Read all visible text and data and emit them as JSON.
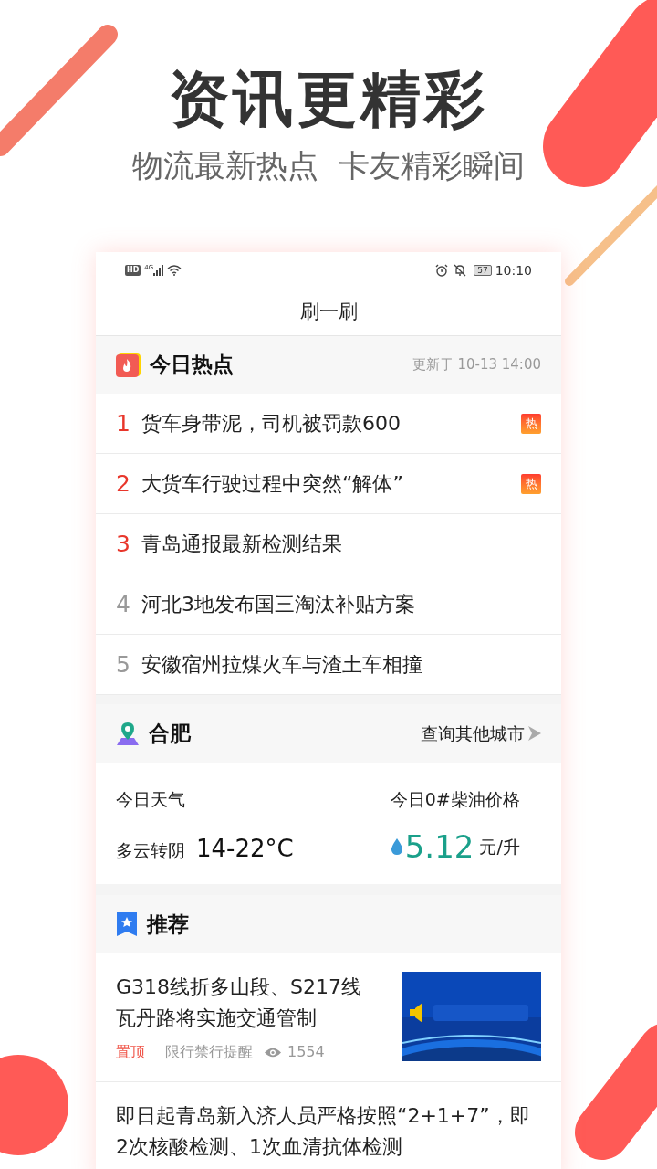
{
  "promo": {
    "headline": "资讯更精彩",
    "subtitle": "物流最新热点  卡友精彩瞬间"
  },
  "status_bar": {
    "hd": "HD",
    "network": "4G",
    "battery": "57",
    "time": "10:10"
  },
  "app_title": "刷一刷",
  "hot": {
    "title": "今日热点",
    "updated": "更新于 10-13 14:00",
    "items": [
      {
        "rank": "1",
        "title": "货车身带泥，司机被罚款600",
        "top": true,
        "hot_badge": "热"
      },
      {
        "rank": "2",
        "title": "大货车行驶过程中突然“解体”",
        "top": true,
        "hot_badge": "热"
      },
      {
        "rank": "3",
        "title": "青岛通报最新检测结果",
        "top": true
      },
      {
        "rank": "4",
        "title": "河北3地发布国三淘汰补贴方案",
        "top": false
      },
      {
        "rank": "5",
        "title": "安徽宿州拉煤火车与渣土车相撞",
        "top": false
      }
    ]
  },
  "city": {
    "name": "合肥",
    "other_link": "查询其他城市",
    "weather_label": "今日天气",
    "weather": "多云转阴",
    "temperature": "14-22°C",
    "fuel_label": "今日0#柴油价格",
    "fuel_price": "5.12",
    "fuel_unit": "元/升"
  },
  "recommend": {
    "title": "推荐",
    "articles": [
      {
        "title": "G318线折多山段、S217线瓦丹路将实施交通管制",
        "tag": "置顶",
        "category": "限行禁行提醒",
        "views": "1554"
      },
      {
        "title": "即日起青岛新入济人员严格按照“2+1+7”，即2次核酸检测、1次血清抗体检测"
      }
    ]
  }
}
